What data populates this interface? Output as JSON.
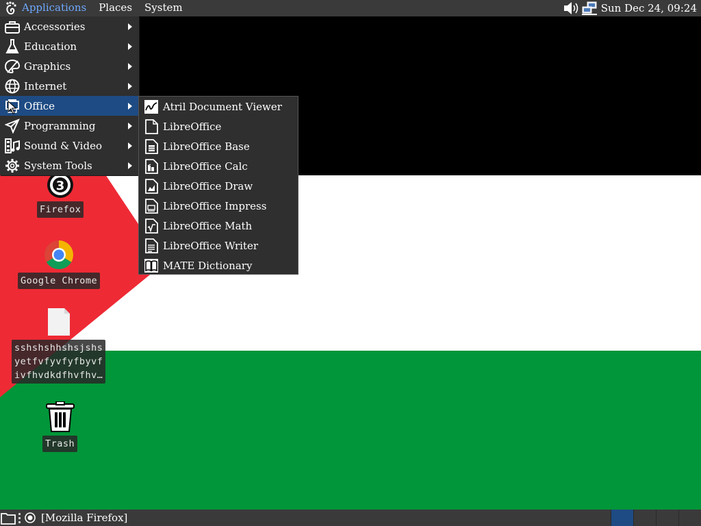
{
  "top_panel": {
    "menus": [
      "Applications",
      "Places",
      "System"
    ],
    "clock": "Sun Dec 24, 09:24",
    "tray_icons": [
      "volume-icon",
      "network-icon"
    ]
  },
  "applications_menu": {
    "items": [
      {
        "label": "Accessories",
        "icon": "toolbox-icon"
      },
      {
        "label": "Education",
        "icon": "flask-icon"
      },
      {
        "label": "Graphics",
        "icon": "palette-icon"
      },
      {
        "label": "Internet",
        "icon": "globe-icon"
      },
      {
        "label": "Office",
        "icon": "office-icon",
        "selected": true
      },
      {
        "label": "Programming",
        "icon": "programming-icon"
      },
      {
        "label": "Sound & Video",
        "icon": "multimedia-icon"
      },
      {
        "label": "System Tools",
        "icon": "gear-icon"
      }
    ]
  },
  "office_submenu": {
    "items": [
      {
        "label": "Atril Document Viewer",
        "icon": "atril-icon"
      },
      {
        "label": "LibreOffice",
        "icon": "libreoffice-icon"
      },
      {
        "label": "LibreOffice Base",
        "icon": "libreoffice-base-icon"
      },
      {
        "label": "LibreOffice Calc",
        "icon": "libreoffice-calc-icon"
      },
      {
        "label": "LibreOffice Draw",
        "icon": "libreoffice-draw-icon"
      },
      {
        "label": "LibreOffice Impress",
        "icon": "libreoffice-impress-icon"
      },
      {
        "label": "LibreOffice Math",
        "icon": "libreoffice-math-icon"
      },
      {
        "label": "LibreOffice Writer",
        "icon": "libreoffice-writer-icon"
      },
      {
        "label": "MATE Dictionary",
        "icon": "dictionary-icon"
      }
    ]
  },
  "desktop": {
    "icons": [
      {
        "label": "Firefox",
        "icon": "firefox-icon"
      },
      {
        "label": "Google Chrome",
        "icon": "chrome-icon"
      },
      {
        "label": "sshshshhshsjshs\nyetfvfyvfyfbyvf\nivfhvdkdfhvfhv…",
        "icon": "file-icon"
      },
      {
        "label": "Trash",
        "icon": "trash-icon"
      }
    ],
    "wallpaper_colors": {
      "black": "#000000",
      "white": "#ffffff",
      "green": "#009639",
      "red": "#ee2a35"
    }
  },
  "bottom_panel": {
    "taskbar": [
      {
        "label": "[Mozilla Firefox]",
        "icon": "firefox-icon"
      }
    ],
    "workspace_count": 4,
    "active_workspace": 1
  },
  "colors": {
    "panel_bg": "#3a3a3a",
    "menu_bg": "#2f2f2f",
    "selection": "#1e4b83",
    "apps_label": "#6fa8ff"
  }
}
